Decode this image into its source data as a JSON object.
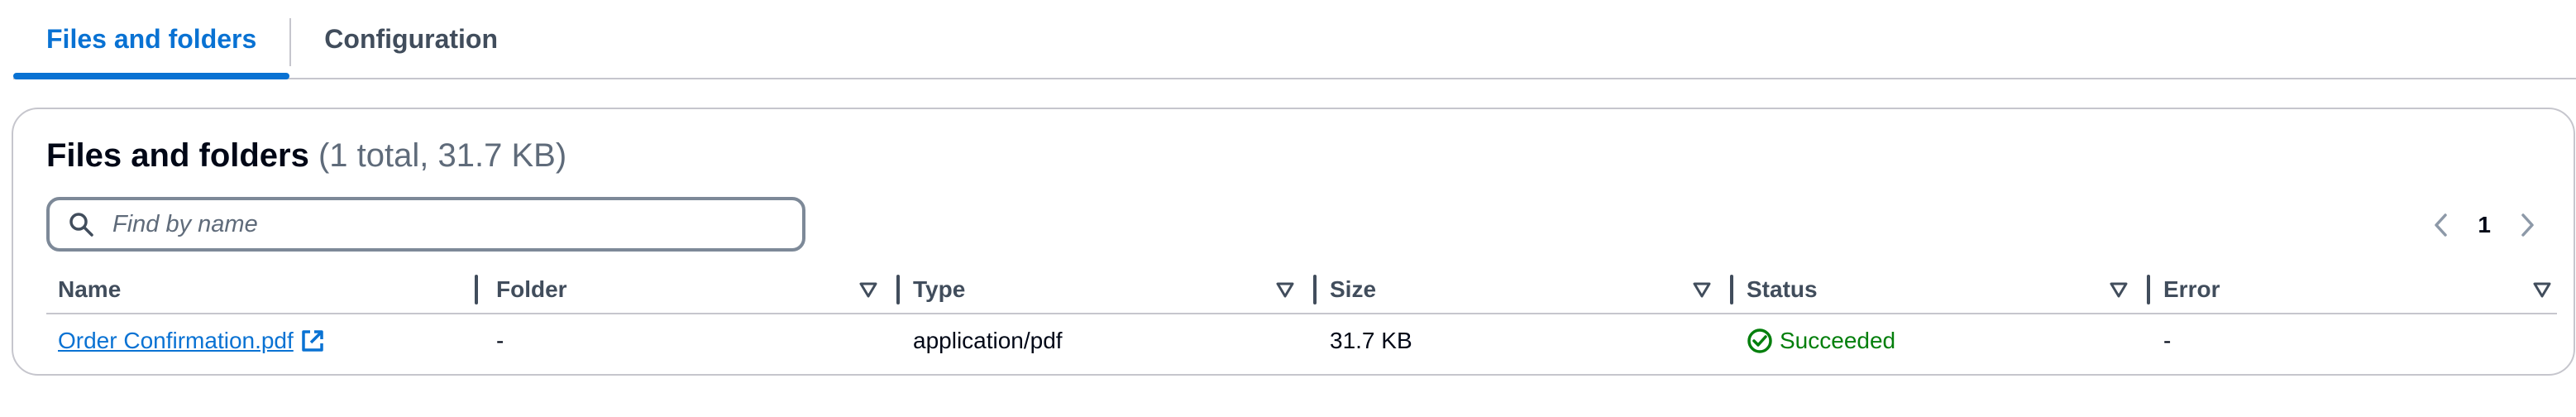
{
  "tabs": [
    {
      "label": "Files and folders",
      "active": true
    },
    {
      "label": "Configuration",
      "active": false
    }
  ],
  "panel": {
    "title": "Files and folders",
    "counter": "(1 total, 31.7 KB)"
  },
  "search": {
    "placeholder": "Find by name",
    "value": "",
    "icon": "search-icon"
  },
  "pagination": {
    "current_page": "1",
    "prev_icon": "chevron-left-icon",
    "next_icon": "chevron-right-icon"
  },
  "table": {
    "columns": [
      "Name",
      "Folder",
      "Type",
      "Size",
      "Status",
      "Error"
    ],
    "rows": [
      {
        "name": "Order Confirmation.pdf",
        "folder": "-",
        "type": "application/pdf",
        "size": "31.7 KB",
        "status": "Succeeded",
        "error": "-"
      }
    ]
  },
  "colors": {
    "accent": "#0972d3",
    "success": "#037f0c",
    "border": "#c6c6cd",
    "text_secondary": "#5f6b7a"
  }
}
